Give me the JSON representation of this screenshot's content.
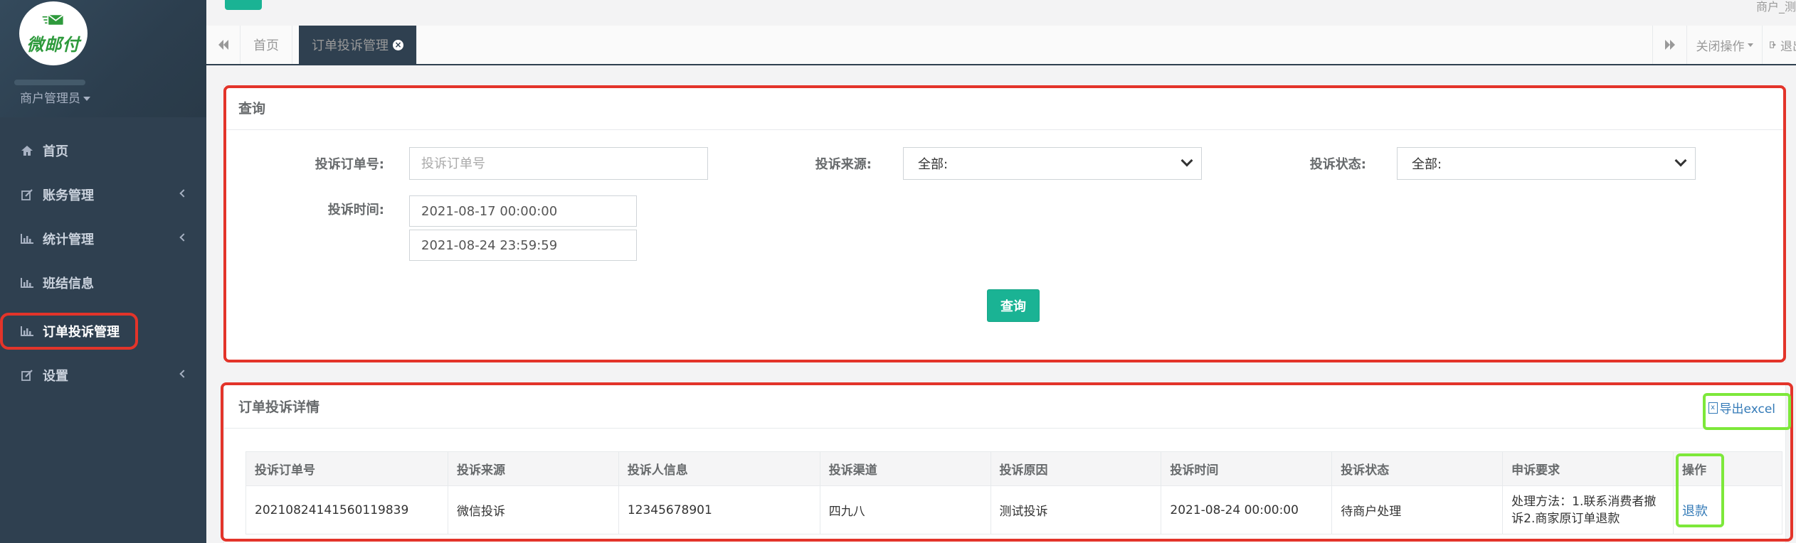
{
  "brand": {
    "logo_text": "微邮付",
    "role": "商户管理员"
  },
  "colors": {
    "sidebar": "#2f4050",
    "accent": "#1ab394",
    "annotation_red": "#e3342a",
    "annotation_green": "#7de83a",
    "link": "#337ab7"
  },
  "sidebar": {
    "items": [
      {
        "label": "首页",
        "icon": "home-icon"
      },
      {
        "label": "账务管理",
        "icon": "edit-icon"
      },
      {
        "label": "统计管理",
        "icon": "bar-chart-icon"
      },
      {
        "label": "班结信息",
        "icon": "bar-chart-icon"
      },
      {
        "label": "订单投诉管理",
        "icon": "bar-chart-icon"
      },
      {
        "label": "设置",
        "icon": "edit-icon"
      }
    ]
  },
  "topbar": {
    "corner_text": "商户_测"
  },
  "tabs": {
    "home": "首页",
    "active": "订单投诉管理",
    "close_ops": "关闭操作",
    "logout": "退出"
  },
  "query": {
    "title": "查询",
    "order_no_label": "投诉订单号:",
    "order_no_placeholder": "投诉订单号",
    "source_label": "投诉来源:",
    "source_value": "全部:",
    "status_label": "投诉状态:",
    "status_value": "全部:",
    "time_label": "投诉时间:",
    "time_start": "2021-08-17 00:00:00",
    "time_end": "2021-08-24 23:59:59",
    "button": "查询"
  },
  "details": {
    "title": "订单投诉详情",
    "export": "导出excel",
    "columns": [
      "投诉订单号",
      "投诉来源",
      "投诉人信息",
      "投诉渠道",
      "投诉原因",
      "投诉时间",
      "投诉状态",
      "申诉要求",
      "操作"
    ],
    "rows": [
      {
        "order_no": "20210824141560119839",
        "source": "微信投诉",
        "complainant": "12345678901",
        "channel": "四九八",
        "reason": "测试投诉",
        "time": "2021-08-24 00:00:00",
        "status": "待商户处理",
        "request": "处理方法：1.联系消费者撤诉2.商家原订单退款",
        "action": "退款"
      }
    ]
  }
}
